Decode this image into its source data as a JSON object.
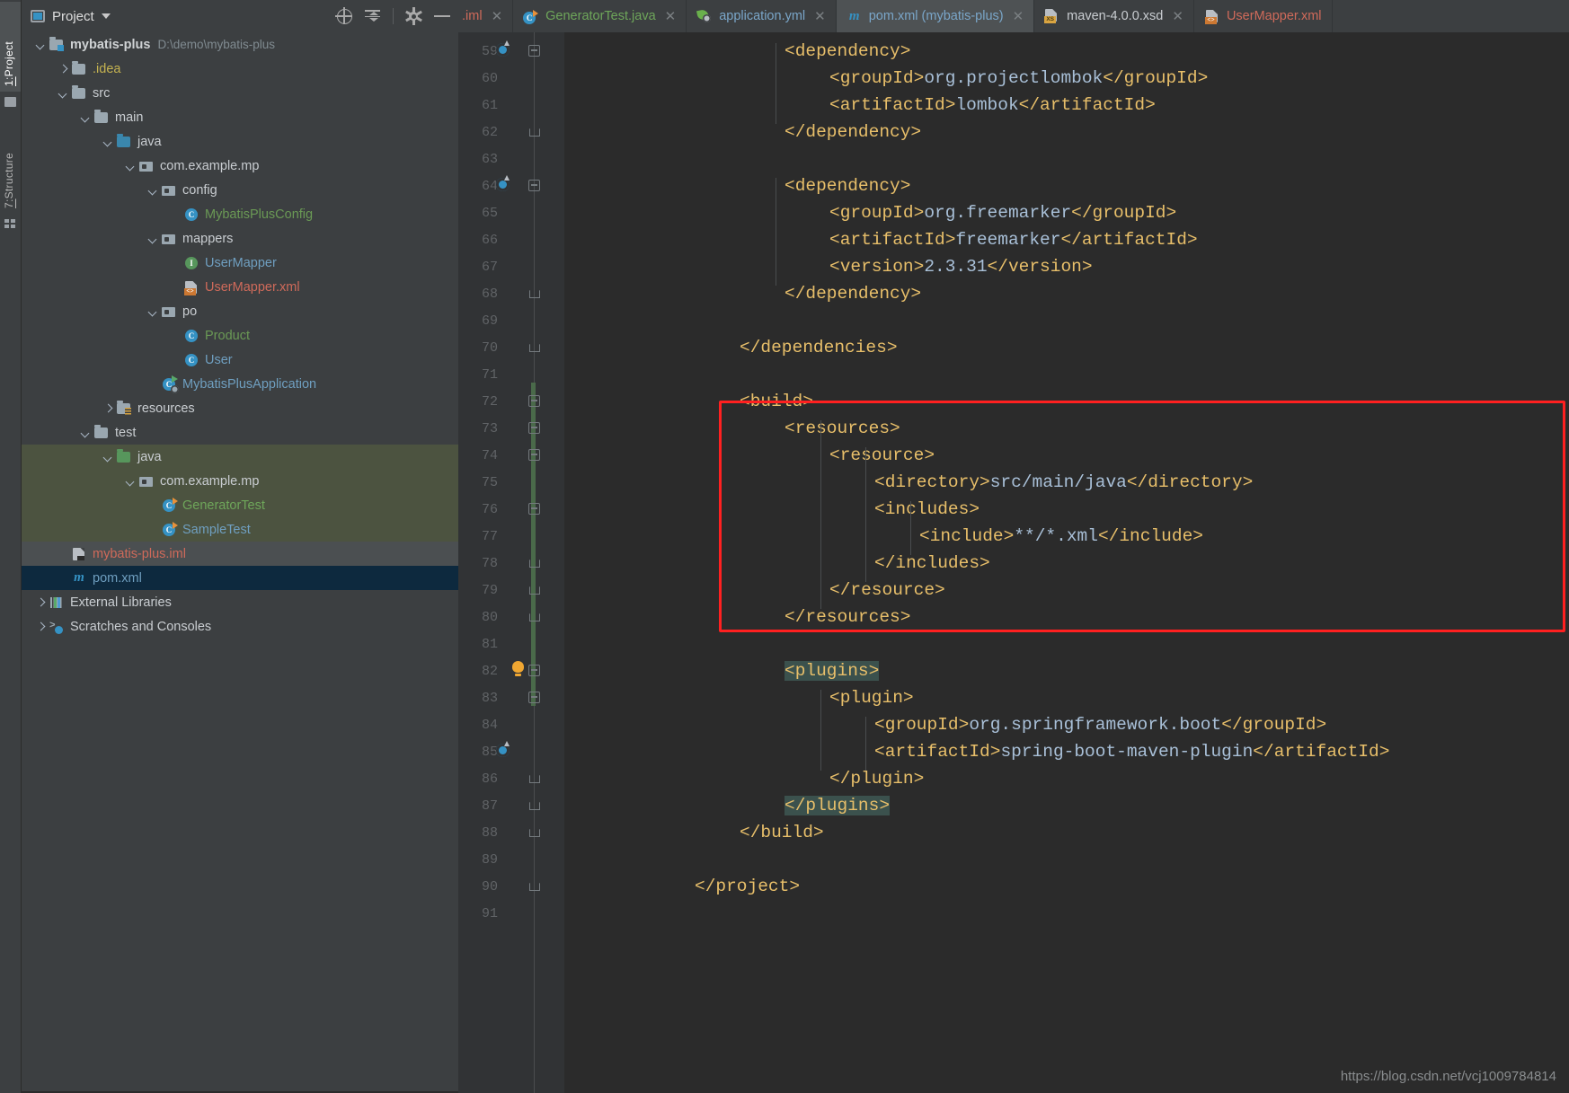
{
  "toolwindows": {
    "left_tabs": [
      {
        "num": "1:",
        "label": "Project",
        "selected": true
      },
      {
        "num": "7:",
        "label": "Structure",
        "selected": false
      }
    ]
  },
  "project_panel": {
    "title": "Project",
    "toolbar": [
      {
        "name": "select-opened-file-icon",
        "tooltip": "Select Opened File"
      },
      {
        "name": "collapse-all-icon",
        "tooltip": "Collapse All"
      },
      {
        "name": "settings-gear-icon",
        "tooltip": "Settings"
      },
      {
        "name": "hide-icon",
        "tooltip": "Hide"
      }
    ],
    "tree": [
      {
        "depth": 0,
        "arrow": "d",
        "icon": "folder-module",
        "label": "mybatis-plus",
        "style": "bold",
        "path": "D:\\demo\\mybatis-plus"
      },
      {
        "depth": 1,
        "arrow": "r",
        "icon": "folder-grey",
        "label": ".idea",
        "style": "yellow"
      },
      {
        "depth": 1,
        "arrow": "d",
        "icon": "folder-grey",
        "label": "src",
        "style": "white"
      },
      {
        "depth": 2,
        "arrow": "d",
        "icon": "folder-grey",
        "label": "main",
        "style": "white"
      },
      {
        "depth": 3,
        "arrow": "d",
        "icon": "folder-blue",
        "label": "java",
        "style": "white"
      },
      {
        "depth": 4,
        "arrow": "d",
        "icon": "package",
        "label": "com.example.mp",
        "style": "white"
      },
      {
        "depth": 5,
        "arrow": "d",
        "icon": "package",
        "label": "config",
        "style": "white"
      },
      {
        "depth": 6,
        "arrow": "none",
        "icon": "class",
        "label": "MybatisPlusConfig",
        "style": "green"
      },
      {
        "depth": 5,
        "arrow": "d",
        "icon": "package",
        "label": "mappers",
        "style": "white"
      },
      {
        "depth": 6,
        "arrow": "none",
        "icon": "interface",
        "label": "UserMapper",
        "style": "blue"
      },
      {
        "depth": 6,
        "arrow": "none",
        "icon": "xml",
        "label": "UserMapper.xml",
        "style": "red"
      },
      {
        "depth": 5,
        "arrow": "d",
        "icon": "package",
        "label": "po",
        "style": "white"
      },
      {
        "depth": 6,
        "arrow": "none",
        "icon": "class",
        "label": "Product",
        "style": "green"
      },
      {
        "depth": 6,
        "arrow": "none",
        "icon": "class",
        "label": "User",
        "style": "blue"
      },
      {
        "depth": 5,
        "arrow": "none",
        "icon": "spring-class",
        "label": "MybatisPlusApplication",
        "style": "blue"
      },
      {
        "depth": 3,
        "arrow": "r",
        "icon": "folder-res",
        "label": "resources",
        "style": "white"
      },
      {
        "depth": 2,
        "arrow": "d",
        "icon": "folder-grey",
        "label": "test",
        "style": "white"
      },
      {
        "depth": 3,
        "arrow": "d",
        "icon": "folder-green",
        "label": "java",
        "style": "white",
        "highlight": "test"
      },
      {
        "depth": 4,
        "arrow": "d",
        "icon": "package",
        "label": "com.example.mp",
        "style": "white",
        "highlight": "test"
      },
      {
        "depth": 5,
        "arrow": "none",
        "icon": "test-class",
        "label": "GeneratorTest",
        "style": "greenish",
        "highlight": "test"
      },
      {
        "depth": 5,
        "arrow": "none",
        "icon": "test-class",
        "label": "SampleTest",
        "style": "blue",
        "highlight": "test"
      },
      {
        "depth": 1,
        "arrow": "none",
        "icon": "iml",
        "label": "mybatis-plus.iml",
        "style": "red",
        "highlight": "grey"
      },
      {
        "depth": 1,
        "arrow": "none",
        "icon": "maven",
        "label": "pom.xml",
        "style": "blue",
        "highlight": "blue"
      },
      {
        "depth": 0,
        "arrow": "r",
        "icon": "libraries",
        "label": "External Libraries",
        "style": "white"
      },
      {
        "depth": 0,
        "arrow": "r",
        "icon": "scratches",
        "label": "Scratches and Consoles",
        "style": "white"
      }
    ]
  },
  "editor": {
    "tabs": [
      {
        "label": ".iml",
        "icon": "none",
        "style": "red",
        "active": false,
        "closable": true,
        "partial": true
      },
      {
        "label": "GeneratorTest.java",
        "icon": "test-class",
        "style": "greenish",
        "active": false,
        "closable": true
      },
      {
        "label": "application.yml",
        "icon": "spring-leaf",
        "style": "blue",
        "active": false,
        "closable": true
      },
      {
        "label": "pom.xml (mybatis-plus)",
        "icon": "maven",
        "style": "blue",
        "active": true,
        "closable": true
      },
      {
        "label": "maven-4.0.0.xsd",
        "icon": "xsd",
        "style": "white",
        "active": false,
        "closable": true
      },
      {
        "label": "UserMapper.xml",
        "icon": "xml",
        "style": "red",
        "active": false,
        "closable": false,
        "partial": true
      }
    ],
    "first_line_number": 59,
    "lines": [
      {
        "n": 59,
        "indent": 2,
        "gutter_icon": "bean",
        "fold": "minus",
        "spans": [
          {
            "t": "<dependency>",
            "c": "tag"
          }
        ]
      },
      {
        "n": 60,
        "indent": 3,
        "fold": "none",
        "spans": [
          {
            "t": "<groupId>",
            "c": "tag"
          },
          {
            "t": "org.projectlombok",
            "c": "txt"
          },
          {
            "t": "</groupId>",
            "c": "tag"
          }
        ]
      },
      {
        "n": 61,
        "indent": 3,
        "fold": "none",
        "spans": [
          {
            "t": "<artifactId>",
            "c": "tag"
          },
          {
            "t": "lombok",
            "c": "txt"
          },
          {
            "t": "</artifactId>",
            "c": "tag"
          }
        ]
      },
      {
        "n": 62,
        "indent": 2,
        "fold": "end",
        "spans": [
          {
            "t": "</dependency>",
            "c": "tag"
          }
        ]
      },
      {
        "n": 63,
        "indent": 0,
        "fold": "none",
        "spans": []
      },
      {
        "n": 64,
        "indent": 2,
        "gutter_icon": "bean",
        "fold": "minus",
        "spans": [
          {
            "t": "<dependency>",
            "c": "tag"
          }
        ]
      },
      {
        "n": 65,
        "indent": 3,
        "fold": "none",
        "spans": [
          {
            "t": "<groupId>",
            "c": "tag"
          },
          {
            "t": "org.freemarker",
            "c": "txt"
          },
          {
            "t": "</groupId>",
            "c": "tag"
          }
        ]
      },
      {
        "n": 66,
        "indent": 3,
        "fold": "none",
        "spans": [
          {
            "t": "<artifactId>",
            "c": "tag"
          },
          {
            "t": "freemarker",
            "c": "txt"
          },
          {
            "t": "</artifactId>",
            "c": "tag"
          }
        ]
      },
      {
        "n": 67,
        "indent": 3,
        "fold": "none",
        "spans": [
          {
            "t": "<version>",
            "c": "tag"
          },
          {
            "t": "2.3.31",
            "c": "txt"
          },
          {
            "t": "</version>",
            "c": "tag"
          }
        ]
      },
      {
        "n": 68,
        "indent": 2,
        "fold": "end",
        "spans": [
          {
            "t": "</dependency>",
            "c": "tag"
          }
        ]
      },
      {
        "n": 69,
        "indent": 0,
        "fold": "none",
        "spans": []
      },
      {
        "n": 70,
        "indent": 1,
        "fold": "end",
        "spans": [
          {
            "t": "</dependencies>",
            "c": "tag"
          }
        ]
      },
      {
        "n": 71,
        "indent": 0,
        "fold": "none",
        "spans": []
      },
      {
        "n": 72,
        "indent": 1,
        "fold": "minus",
        "spans": [
          {
            "t": "<build>",
            "c": "tag"
          }
        ]
      },
      {
        "n": 73,
        "indent": 2,
        "fold": "minus",
        "spans": [
          {
            "t": "<resources>",
            "c": "tag"
          }
        ]
      },
      {
        "n": 74,
        "indent": 3,
        "fold": "minus",
        "spans": [
          {
            "t": "<resource>",
            "c": "tag"
          }
        ]
      },
      {
        "n": 75,
        "indent": 4,
        "fold": "none",
        "spans": [
          {
            "t": "<directory>",
            "c": "tag"
          },
          {
            "t": "src/main/java",
            "c": "txt"
          },
          {
            "t": "</directory>",
            "c": "tag"
          }
        ]
      },
      {
        "n": 76,
        "indent": 4,
        "fold": "minus",
        "spans": [
          {
            "t": "<includes>",
            "c": "tag"
          }
        ]
      },
      {
        "n": 77,
        "indent": 5,
        "fold": "none",
        "spans": [
          {
            "t": "<include>",
            "c": "tag"
          },
          {
            "t": "**/*.xml",
            "c": "txt"
          },
          {
            "t": "</include>",
            "c": "tag"
          }
        ]
      },
      {
        "n": 78,
        "indent": 4,
        "fold": "end",
        "spans": [
          {
            "t": "</includes>",
            "c": "tag"
          }
        ]
      },
      {
        "n": 79,
        "indent": 3,
        "fold": "end",
        "spans": [
          {
            "t": "</resource>",
            "c": "tag"
          }
        ]
      },
      {
        "n": 80,
        "indent": 2,
        "fold": "end",
        "spans": [
          {
            "t": "</resources>",
            "c": "tag"
          }
        ]
      },
      {
        "n": 81,
        "indent": 0,
        "fold": "none",
        "spans": []
      },
      {
        "n": 82,
        "indent": 2,
        "fold": "minus",
        "gutter_icon": "bulb",
        "spans": [
          {
            "t": "<plugins>",
            "c": "tag",
            "hl": true
          }
        ]
      },
      {
        "n": 83,
        "indent": 3,
        "fold": "minus",
        "spans": [
          {
            "t": "<plugin>",
            "c": "tag"
          }
        ]
      },
      {
        "n": 84,
        "indent": 4,
        "fold": "none",
        "spans": [
          {
            "t": "<groupId>",
            "c": "tag"
          },
          {
            "t": "org.springframework.boot",
            "c": "txt"
          },
          {
            "t": "</groupId>",
            "c": "tag"
          }
        ]
      },
      {
        "n": 85,
        "indent": 4,
        "gutter_icon": "bean",
        "fold": "none",
        "spans": [
          {
            "t": "<artifactId>",
            "c": "tag"
          },
          {
            "t": "spring-boot-maven-plugin",
            "c": "txt"
          },
          {
            "t": "</artifactId>",
            "c": "tag"
          }
        ]
      },
      {
        "n": 86,
        "indent": 3,
        "fold": "end",
        "spans": [
          {
            "t": "</plugin>",
            "c": "tag"
          }
        ]
      },
      {
        "n": 87,
        "indent": 2,
        "fold": "end",
        "spans": [
          {
            "t": "</plugins>",
            "c": "tag",
            "hl": true
          }
        ]
      },
      {
        "n": 88,
        "indent": 1,
        "fold": "end",
        "spans": [
          {
            "t": "</build>",
            "c": "tag"
          }
        ]
      },
      {
        "n": 89,
        "indent": 0,
        "fold": "none",
        "spans": []
      },
      {
        "n": 90,
        "indent": 0,
        "fold": "end",
        "spans": [
          {
            "t": "</project>",
            "c": "tag"
          }
        ]
      },
      {
        "n": 91,
        "indent": 0,
        "fold": "none",
        "spans": []
      }
    ],
    "annotation": {
      "type": "red-rectangle",
      "color": "#ff2020",
      "covers_lines": "73-80",
      "description": "red highlight box around the <resources> block"
    }
  },
  "watermark": "https://blog.csdn.net/vcj1009784814",
  "colors": {
    "bg_editor": "#2b2b2b",
    "bg_panel": "#3c3f41",
    "bg_gutter": "#313335",
    "tag": "#e8bf6a",
    "text_value": "#a9c0d8",
    "selection_blue": "#0d293e",
    "test_root_green": "#4c5340",
    "annotation_red": "#ff2020",
    "match_highlight": "#3b514d"
  }
}
